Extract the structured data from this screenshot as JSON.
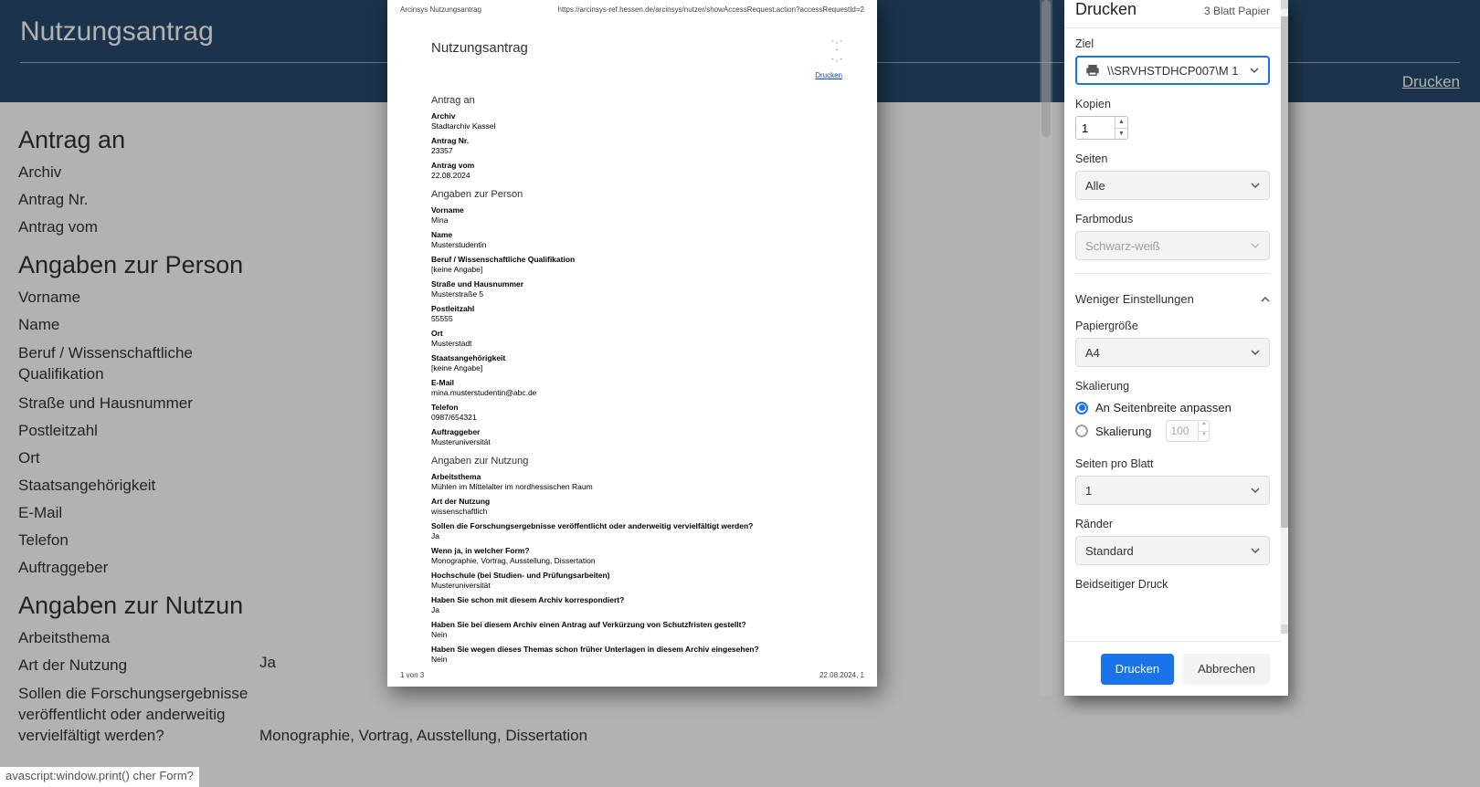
{
  "page": {
    "title": "Nutzungsantrag",
    "print_link": "Drucken",
    "js_status": "avascript:window.print()  cher Form?",
    "left": {
      "h_antrag": "Antrag an",
      "items_antrag": [
        "Archiv",
        "Antrag Nr.",
        "Antrag vom"
      ],
      "h_person": "Angaben zur Person",
      "items_person": [
        "Vorname",
        "Name",
        "Beruf / Wissenschaftliche Qualifikation",
        "Straße und Hausnummer",
        "Postleitzahl",
        "Ort",
        "Staatsangehörigkeit",
        "E-Mail",
        "Telefon",
        "Auftraggeber"
      ],
      "h_nutzung": "Angaben zur Nutzun",
      "items_nutzung": [
        "Arbeitsthema",
        "Art der Nutzung",
        "Sollen die Forschungsergebnisse veröffentlicht oder anderweitig vervielfältigt werden?"
      ]
    },
    "right_val_1": "Ja",
    "right_val_2": "Monographie, Vortrag, Ausstellung, Dissertation"
  },
  "preview": {
    "hdr_left": "Arcinsys Nutzungsantrag",
    "hdr_right": "https://arcinsys-ref.hessen.de/arcinsys/nutzer/showAccessRequest.action?accessRequestId=2",
    "topright": "- , -\n-\n- , -",
    "doc_title": "Nutzungsantrag",
    "link_print": "Drucken",
    "sec_antrag": "Antrag an",
    "antrag": {
      "archiv_l": "Archiv",
      "archiv_v": "Stadtarchiv Kassel",
      "nr_l": "Antrag Nr.",
      "nr_v": "23357",
      "vom_l": "Antrag vom",
      "vom_v": "22.08.2024"
    },
    "sec_person": "Angaben zur Person",
    "person": {
      "vorname_l": "Vorname",
      "vorname_v": "Mina",
      "name_l": "Name",
      "name_v": "Musterstudentin",
      "beruf_l": "Beruf / Wissenschaftliche Qualifikation",
      "beruf_v": "[keine Angabe]",
      "str_l": "Straße und Hausnummer",
      "str_v": "Musterstraße 5",
      "plz_l": "Postleitzahl",
      "plz_v": "55555",
      "ort_l": "Ort",
      "ort_v": "Musterstadt",
      "nat_l": "Staatsangehörigkeit",
      "nat_v": "[keine Angabe]",
      "mail_l": "E-Mail",
      "mail_v": "mina.musterstudentin@abc.de",
      "tel_l": "Telefon",
      "tel_v": "0987/654321",
      "auf_l": "Auftraggeber",
      "auf_v": "Musteruniversität"
    },
    "sec_nutzung": "Angaben zur Nutzung",
    "nutzung": {
      "thema_l": "Arbeitsthema",
      "thema_v": "Mühlen im Mittelalter im nordhessischen Raum",
      "art_l": "Art der Nutzung",
      "art_v": "wissenschaftlich",
      "publ_l": "Sollen die Forschungsergebnisse veröffentlicht oder anderweitig vervielfältigt werden?",
      "publ_v": "Ja",
      "form_l": "Wenn ja, in welcher Form?",
      "form_v": "Monographie, Vortrag, Ausstellung, Dissertation",
      "hs_l": "Hochschule (bei Studien- und Prüfungsarbeiten)",
      "hs_v": "Musteruniversität",
      "korr_l": "Haben Sie schon mit diesem Archiv korrespondiert?",
      "korr_v": "Ja",
      "verk_l": "Haben Sie bei diesem Archiv einen Antrag auf Verkürzung von Schutzfristen gestellt?",
      "verk_v": "Nein",
      "frueh_l": "Haben Sie wegen dieses Themas schon früher Unterlagen in diesem Archiv eingesehen?",
      "frueh_v": "Nein"
    },
    "ftr_left": "1 von 3",
    "ftr_right": "22.08.2024, 1"
  },
  "dlg": {
    "title": "Drucken",
    "subtitle": "3 Blatt Papier",
    "ziel_l": "Ziel",
    "ziel_v": "\\\\SRVHSTDHCP007\\M 1",
    "kopien_l": "Kopien",
    "kopien_v": "1",
    "seiten_l": "Seiten",
    "seiten_v": "Alle",
    "farb_l": "Farbmodus",
    "farb_v": "Schwarz-weiß",
    "less": "Weniger Einstellungen",
    "papier_l": "Papiergröße",
    "papier_v": "A4",
    "skal_l": "Skalierung",
    "skal_fit": "An Seitenbreite anpassen",
    "skal_custom": "Skalierung",
    "skal_val": "100",
    "spb_l": "Seiten pro Blatt",
    "spb_v": "1",
    "rand_l": "Ränder",
    "rand_v": "Standard",
    "duplex_l": "Beidseitiger Druck",
    "btn_print": "Drucken",
    "btn_cancel": "Abbrechen"
  }
}
